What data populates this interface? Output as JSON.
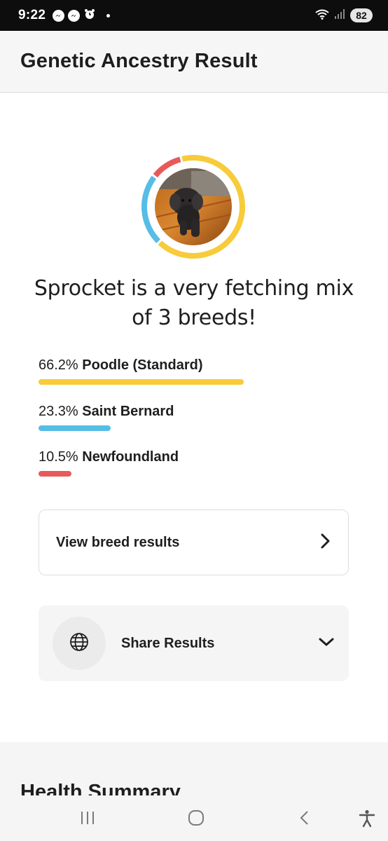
{
  "status_bar": {
    "time": "9:22",
    "battery": "82"
  },
  "header": {
    "title": "Genetic Ancestry Result"
  },
  "result": {
    "headline": "Sprocket is a very fetching mix of 3 breeds!",
    "breeds": [
      {
        "percent": "66.2%",
        "name": "Poodle (Standard)",
        "value": 66.2,
        "color": "#f7cb3a"
      },
      {
        "percent": "23.3%",
        "name": "Saint Bernard",
        "value": 23.3,
        "color": "#56bde6"
      },
      {
        "percent": "10.5%",
        "name": "Newfoundland",
        "value": 10.5,
        "color": "#e85a5a"
      }
    ],
    "view_button_label": "View breed results",
    "share_label": "Share Results"
  },
  "next_section": {
    "title": "Health Summary"
  },
  "icons": {
    "view_chevron": "chevron-right-icon",
    "share_chevron": "chevron-down-icon",
    "globe": "globe-icon",
    "nav_recents": "recents-icon",
    "nav_home": "home-icon",
    "nav_back": "back-icon",
    "nav_accessibility": "accessibility-icon"
  }
}
